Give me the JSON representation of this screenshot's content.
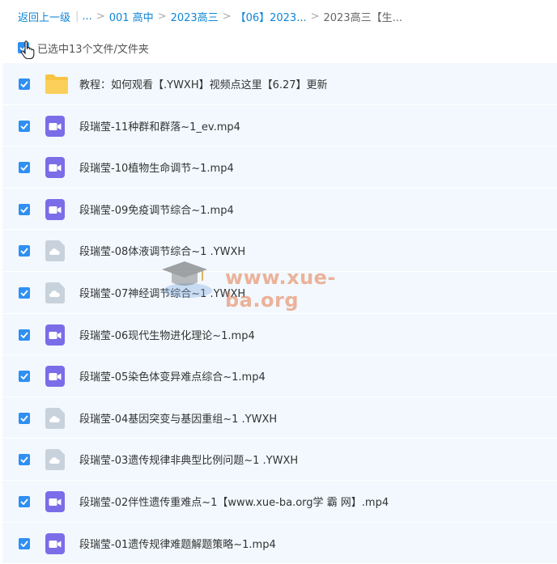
{
  "breadcrumb": {
    "back": "返回上一级",
    "ellipsis": "...",
    "items": [
      "001 高中",
      "2023高三",
      "【06】2023...",
      "2023高三【生..."
    ]
  },
  "selection": {
    "text": "已选中13个文件/文件夹"
  },
  "files": [
    {
      "name": "教程：如何观看【.YWXH】视频点这里【6.27】更新",
      "type": "folder"
    },
    {
      "name": "段瑞莹-11种群和群落~1_ev.mp4",
      "type": "video"
    },
    {
      "name": "段瑞莹-10植物生命调节~1.mp4",
      "type": "video"
    },
    {
      "name": "段瑞莹-09免疫调节综合~1.mp4",
      "type": "video"
    },
    {
      "name": "段瑞莹-08体液调节综合~1 .YWXH",
      "type": "cloud"
    },
    {
      "name": "段瑞莹-07神经调节综合~1 .YWXH",
      "type": "cloud"
    },
    {
      "name": "段瑞莹-06现代生物进化理论~1.mp4",
      "type": "video"
    },
    {
      "name": "段瑞莹-05染色体变异难点综合~1.mp4",
      "type": "video"
    },
    {
      "name": "段瑞莹-04基因突变与基因重组~1 .YWXH",
      "type": "cloud"
    },
    {
      "name": "段瑞莹-03遗传规律非典型比例问题~1 .YWXH",
      "type": "cloud"
    },
    {
      "name": "段瑞莹-02伴性遗传重难点~1【www.xue-ba.org学 霸 网】.mp4",
      "type": "video"
    },
    {
      "name": "段瑞莹-01遗传规律难题解题策略~1.mp4",
      "type": "video"
    }
  ],
  "watermark": {
    "text": "www.xue-ba.org",
    "icon": "graduation-cap-icon"
  },
  "colors": {
    "link": "#0f86d6",
    "checkbox": "#2f8ff2",
    "row_bg": "#f2f8fe",
    "video_icon": "#7b6ce8",
    "folder_icon": "#f8c444",
    "cloud_icon": "#c8d2dc"
  }
}
